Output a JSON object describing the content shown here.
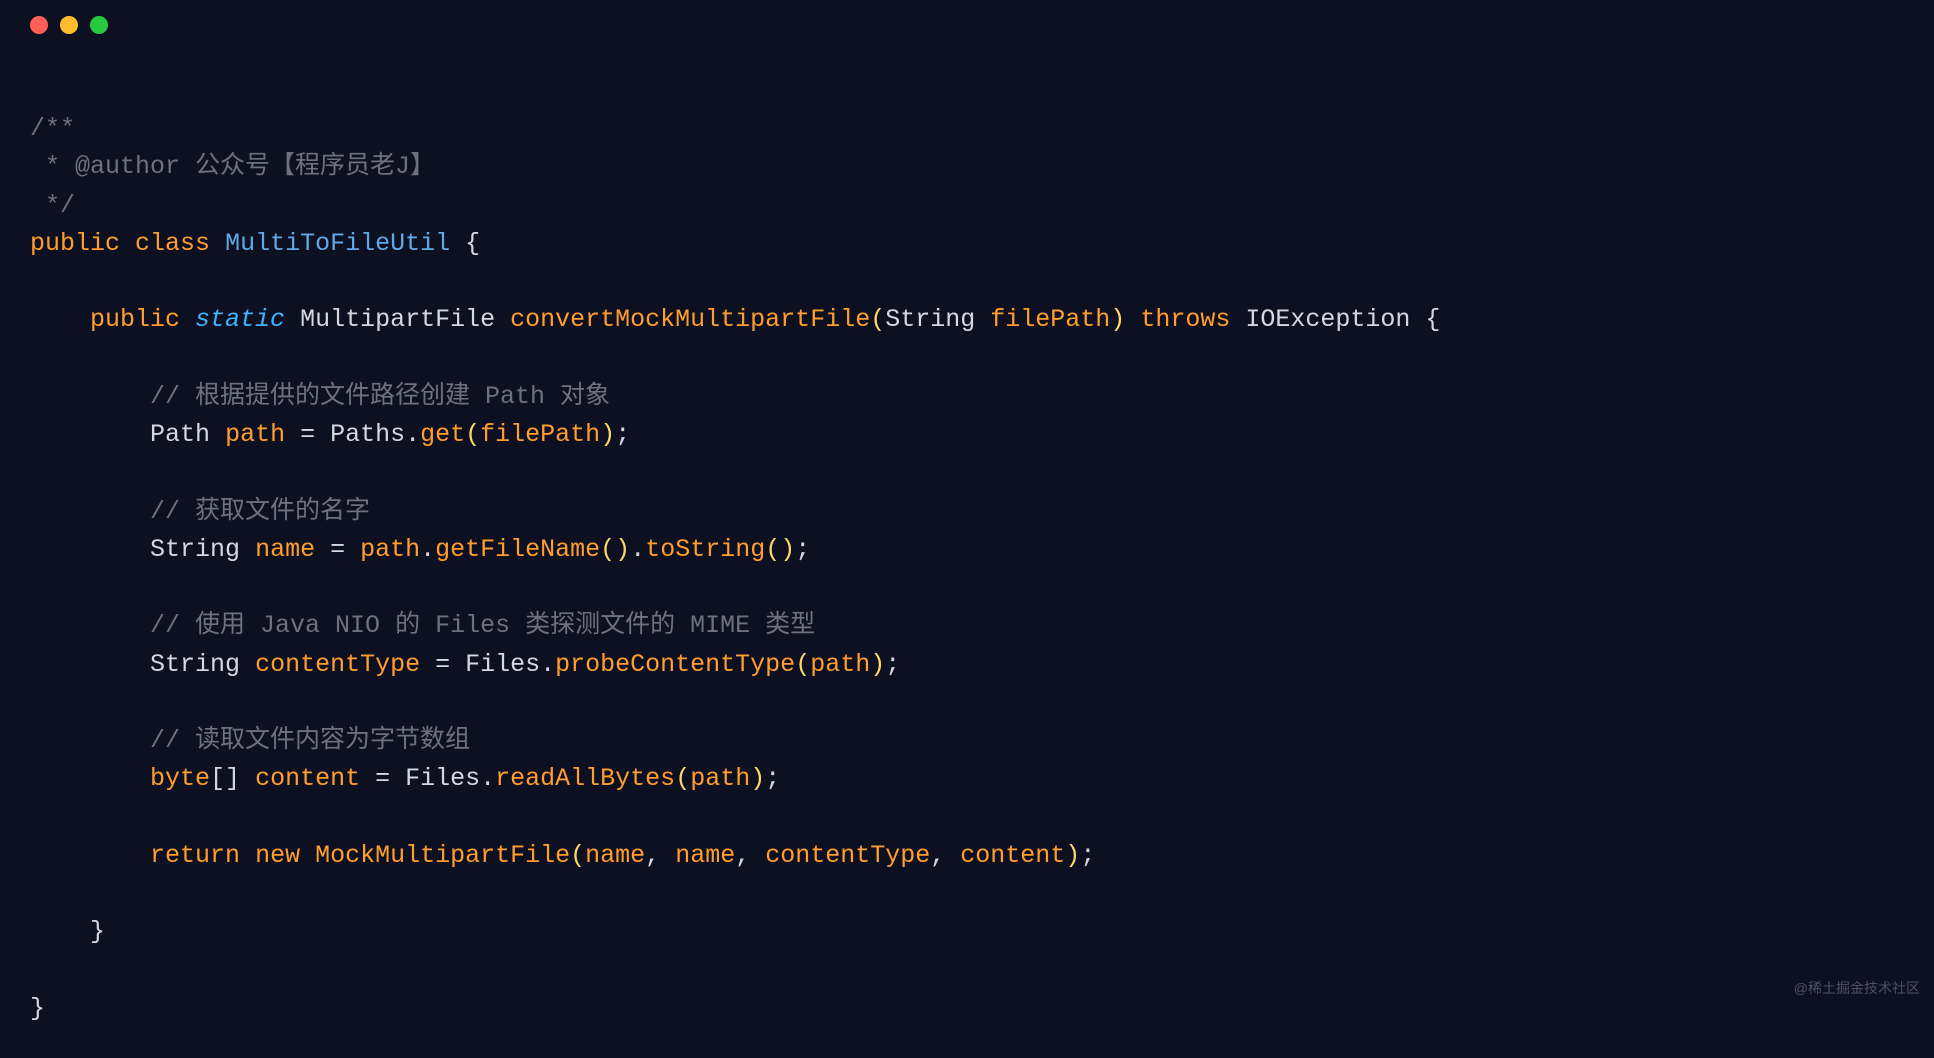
{
  "titlebar": {
    "lights": [
      "close",
      "minimize",
      "zoom"
    ]
  },
  "code": {
    "javadoc_open": "/**",
    "javadoc_author_prefix": " * @author ",
    "javadoc_author_value": "公众号【程序员老J】",
    "javadoc_close": " */",
    "kw_public": "public",
    "kw_class": "class",
    "class_name": "MultiToFileUtil",
    "brace_open": "{",
    "brace_close": "}",
    "kw_static": "static",
    "ret_type": "MultipartFile",
    "method_name": "convertMockMultipartFile",
    "paren_open": "(",
    "paren_close": ")",
    "param_type": "String",
    "param_name": "filePath",
    "kw_throws": "throws",
    "exc_type": "IOException",
    "cmt1": "// 根据提供的文件路径创建 Path 对象",
    "l1_type": "Path",
    "l1_var": "path",
    "l1_eq": " = ",
    "l1_class": "Paths",
    "l1_dot": ".",
    "l1_call": "get",
    "l1_arg": "filePath",
    "semi": ";",
    "cmt2": "// 获取文件的名字",
    "l2_type": "String",
    "l2_var": "name",
    "l2_obj": "path",
    "l2_call1": "getFileName",
    "l2_call2": "toString",
    "cmt3": "// 使用 Java NIO 的 Files 类探测文件的 MIME 类型",
    "l3_type": "String",
    "l3_var": "contentType",
    "l3_class": "Files",
    "l3_call": "probeContentType",
    "l3_arg": "path",
    "cmt4": "// 读取文件内容为字节数组",
    "l4_type": "byte",
    "l4_brackets": "[]",
    "l4_var": "content",
    "l4_class": "Files",
    "l4_call": "readAllBytes",
    "l4_arg": "path",
    "kw_return": "return",
    "kw_new": "new",
    "ctor": "MockMultipartFile",
    "r_arg1": "name",
    "r_arg2": "name",
    "r_arg3": "contentType",
    "r_arg4": "content",
    "comma": ", "
  },
  "watermark": "@稀土掘金技术社区"
}
